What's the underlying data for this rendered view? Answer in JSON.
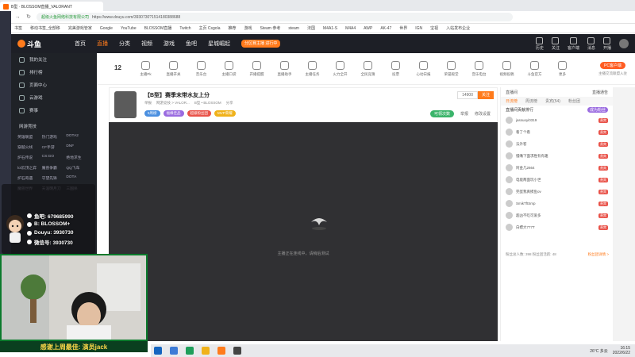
{
  "browser": {
    "tab_title": "B型 · BLOSSOM直播_VALORANT",
    "url_secure_label": "超级火鱼网络科技有限公司",
    "url": "https://www.douyu.com/3930730?1514180388688",
    "bookmarks": [
      "书签",
      "移动书签_全部移",
      "完美游戏管家",
      "Google",
      "YouTube",
      "BLOSSOM直播",
      "Twitch",
      "主页 Csgola",
      "推荐",
      "游戏",
      "Steam 参考",
      "steam",
      "法国",
      "M4A1-S",
      "M4A4",
      "AWP",
      "AK-47",
      "世界",
      "IGN",
      "宝视",
      "入站发布企业"
    ]
  },
  "header": {
    "logo": "斗鱼",
    "nav": [
      "首页",
      "直播",
      "分类",
      "视频",
      "游戏",
      "鱼吧",
      "星城崛起"
    ],
    "active_nav": "直播",
    "promo": "分区赛主播 进行中",
    "right_items": [
      "历史",
      "关注",
      "客户端",
      "消息",
      "开播"
    ]
  },
  "sidebar": {
    "items": [
      "我的关注",
      "排行榜",
      "页面中心",
      "云游戏",
      "赛事"
    ],
    "section": "网游竞技",
    "categories": [
      "英雄联盟",
      "热门游戏",
      "DOTA2",
      "穿越火线",
      "CF手游",
      "DNF",
      "炉石传说",
      "CS:GO",
      "绝地求生",
      "lol云顶之弈",
      "魔兽争霸",
      "QQ飞车",
      "炉石奇遇",
      "守望先锋",
      "DOTA",
      "魔兽世界",
      "天涯明月刀",
      "三国杀"
    ]
  },
  "toolbar": {
    "level_num": "12",
    "items": [
      "主播Pk",
      "直播开关",
      "音乐台",
      "主播口袋",
      "开播提醒",
      "直播助手",
      "主播任务",
      "火力全开",
      "全民竞猜",
      "投票",
      "心动日报",
      "荣誉殿堂",
      "音乐电台",
      "视频投稿",
      "斗鱼官方",
      "更多"
    ],
    "pc_button": "PC客户端",
    "pc_sub": "主播交流联盟入驻"
  },
  "room": {
    "title": "【B型】赛季末带水友上分",
    "sub": [
      "举报",
      "网游竞技 > VALOR...",
      "B型 • BLOSSOM",
      "分享"
    ],
    "badges": [
      "5周榜",
      "福缘佳品",
      "超级粉丝团",
      "MVP荣耀"
    ],
    "follow_count": "14900",
    "follow_label": "关注",
    "tuning_tag": "可领次数",
    "tuning_items": [
      "举报",
      "修改设置"
    ]
  },
  "video": {
    "message": "主播正在连线中，请稍后测试"
  },
  "rightpanel": {
    "title": "直播间",
    "title_right": "直播通告",
    "tabs": [
      "日流榜",
      "周流榜",
      "贵宾(54)",
      "粉丝团"
    ],
    "active_tab": "日流榜",
    "sub_title": "直播间贡献排行",
    "sub_btn": "成为粉丝",
    "rows": [
      {
        "name": "jassuoyi0319",
        "tag": "贵宾"
      },
      {
        "name": "看了个看",
        "tag": "贵宾"
      },
      {
        "name": "法外客",
        "tag": "贵宾"
      },
      {
        "name": "慢嘴下面求胜有有趣",
        "tag": "贵宾"
      },
      {
        "name": "阿金几2664",
        "tag": "贵宾"
      },
      {
        "name": "电能两面玩小世",
        "tag": "贵宾"
      },
      {
        "name": "完蛋我真摸鱼ov",
        "tag": "贵宾"
      },
      {
        "name": "SmikTftSmp",
        "tag": "贵宾"
      },
      {
        "name": "超凶不吃可爱多",
        "tag": "贵宾"
      },
      {
        "name": "白嫖大777T",
        "tag": "贵宾"
      }
    ],
    "foot_left": "粉丝总人数: 398 粉丝团活跃: 48",
    "foot_right": "粉丝团详情 >"
  },
  "overlay": {
    "social": [
      "鱼吧: 679685990",
      "B: BLOSSOM+",
      "Douyu: 3930730",
      "微信号: 3930730"
    ],
    "banner": "感谢上周最佳: 演员jack"
  },
  "taskbar": {
    "weather": "26°C 多云",
    "time": "16:15",
    "date": "2022/6/22"
  },
  "colors": {
    "accent": "#ff7b1c",
    "header_bg": "#1d1f26",
    "video_bg": "#303033",
    "banner_bg": "#0a3f1f"
  }
}
